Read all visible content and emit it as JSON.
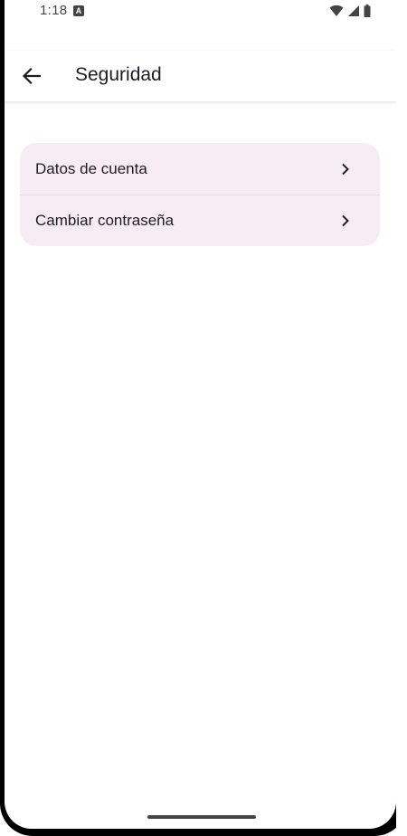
{
  "status_bar": {
    "time": "1:18",
    "notification_icon": "A",
    "icons": [
      "wifi-icon",
      "signal-icon",
      "battery-icon"
    ]
  },
  "app_bar": {
    "back_icon": "arrow-left-icon",
    "title": "Seguridad"
  },
  "menu": {
    "items": [
      {
        "label": "Datos de cuenta",
        "icon": "chevron-right-icon"
      },
      {
        "label": "Cambiar contraseña",
        "icon": "chevron-right-icon"
      }
    ]
  },
  "colors": {
    "card_background": "#f7ecf4",
    "text": "#1f1b22",
    "status_icons": "#444444"
  }
}
